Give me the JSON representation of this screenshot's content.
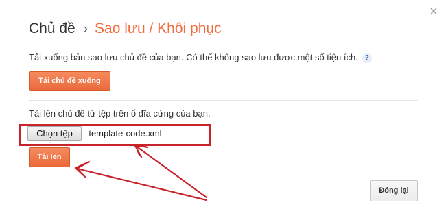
{
  "dialog": {
    "close_icon": "×",
    "breadcrumb_root": "Chủ đề",
    "breadcrumb_separator": "›",
    "breadcrumb_current": "Sao lưu / Khôi phục"
  },
  "backup": {
    "description": "Tải xuống bản sao lưu chủ đề của bạn. Có thể không sao lưu được một số tiện ích.",
    "help_icon": "?",
    "download_label": "Tải chủ đề xuống"
  },
  "restore": {
    "description": "Tải lên chủ đề từ tệp trên ổ đĩa cứng của bạn.",
    "choose_file_label": "Chọn tệp",
    "file_name": "-template-code.xml",
    "upload_label": "Tải lên"
  },
  "footer": {
    "close_label": "Đóng lại"
  },
  "colors": {
    "accent": "#f36c3d",
    "annotation": "#c8222b"
  }
}
